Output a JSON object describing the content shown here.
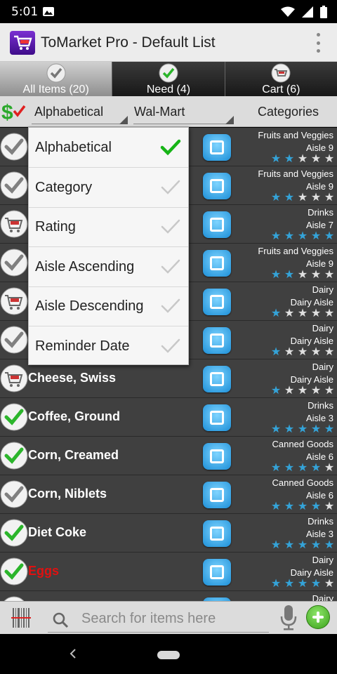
{
  "status_bar": {
    "time": "5:01"
  },
  "app_bar": {
    "title": "ToMarket Pro - Default List"
  },
  "tabs": [
    {
      "label": "All Items (20)",
      "icon": "white-check-icon",
      "active": true
    },
    {
      "label": "Need (4)",
      "icon": "green-check-icon",
      "active": false
    },
    {
      "label": "Cart (6)",
      "icon": "cart-icon",
      "active": false
    }
  ],
  "filter": {
    "sort_value": "Alphabetical",
    "store_value": "Wal-Mart",
    "categories_label": "Categories"
  },
  "sort_menu": {
    "items": [
      {
        "label": "Alphabetical",
        "selected": true
      },
      {
        "label": "Category",
        "selected": false
      },
      {
        "label": "Rating",
        "selected": false
      },
      {
        "label": "Aisle Ascending",
        "selected": false
      },
      {
        "label": "Aisle Descending",
        "selected": false
      },
      {
        "label": "Reminder Date",
        "selected": false
      }
    ]
  },
  "items": [
    {
      "name": "",
      "status": "white-check",
      "category": "Fruits and Veggies",
      "aisle": "Aisle 9",
      "rating": 2
    },
    {
      "name": "",
      "status": "white-check",
      "category": "Fruits and Veggies",
      "aisle": "Aisle 9",
      "rating": 2
    },
    {
      "name": "",
      "status": "cart",
      "category": "Drinks",
      "aisle": "Aisle 7",
      "rating": 5
    },
    {
      "name": "",
      "status": "white-check",
      "category": "Fruits and Veggies",
      "aisle": "Aisle 9",
      "rating": 2
    },
    {
      "name": "",
      "status": "cart",
      "category": "Dairy",
      "aisle": "Dairy Aisle",
      "rating": 1
    },
    {
      "name": "",
      "status": "white-check",
      "category": "Dairy",
      "aisle": "Dairy Aisle",
      "rating": 1
    },
    {
      "name": "Cheese, Swiss",
      "status": "cart",
      "category": "Dairy",
      "aisle": "Dairy Aisle",
      "rating": 1,
      "red": false
    },
    {
      "name": "Coffee, Ground",
      "status": "green-check",
      "category": "Drinks",
      "aisle": "Aisle 3",
      "rating": 5,
      "red": false
    },
    {
      "name": "Corn, Creamed",
      "status": "green-check",
      "category": "Canned Goods",
      "aisle": "Aisle 6",
      "rating": 4,
      "red": false
    },
    {
      "name": "Corn, Niblets",
      "status": "white-check",
      "category": "Canned Goods",
      "aisle": "Aisle 6",
      "rating": 4,
      "red": false
    },
    {
      "name": "Diet Coke",
      "status": "green-check",
      "category": "Drinks",
      "aisle": "Aisle 3",
      "rating": 5,
      "red": false
    },
    {
      "name": "Eggs",
      "status": "green-check",
      "category": "Dairy",
      "aisle": "Dairy Aisle",
      "rating": 4,
      "red": true
    },
    {
      "name": "",
      "status": "white-check",
      "category": "Dairy",
      "aisle": "",
      "rating": 0
    }
  ],
  "search": {
    "placeholder": "Search for items here"
  },
  "colors": {
    "star_on": "#34a3d8",
    "menu_check": "#17b417",
    "accent_green": "#3aa11a"
  }
}
